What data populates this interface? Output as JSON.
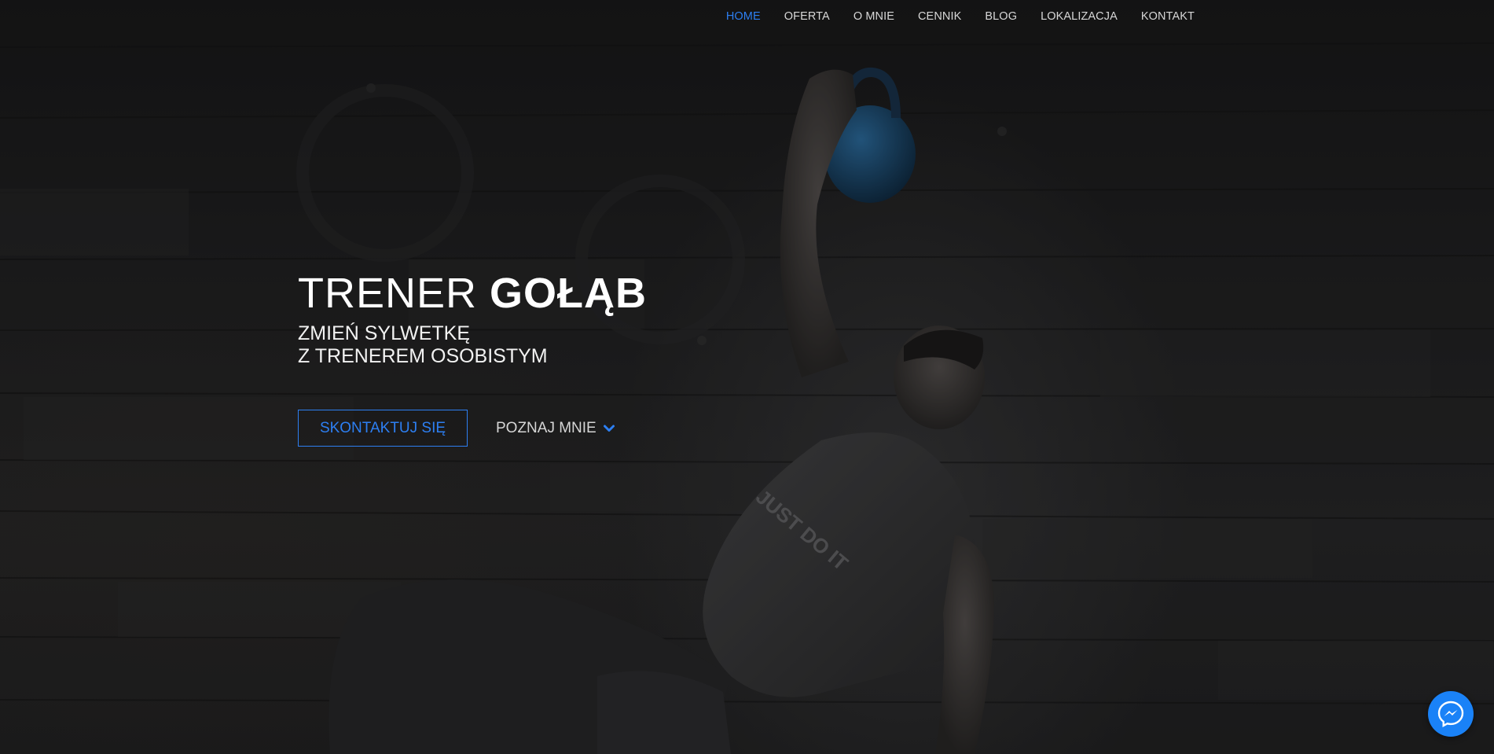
{
  "nav": {
    "items": [
      {
        "label": "HOME",
        "active": true
      },
      {
        "label": "OFERTA",
        "active": false
      },
      {
        "label": "O MNIE",
        "active": false
      },
      {
        "label": "CENNIK",
        "active": false
      },
      {
        "label": "BLOG",
        "active": false
      },
      {
        "label": "LOKALIZACJA",
        "active": false
      },
      {
        "label": "KONTAKT",
        "active": false
      }
    ],
    "active_color": "#2d7ff2",
    "color": "#d8d8d8"
  },
  "hero": {
    "title_light": "TRENER ",
    "title_bold": "GOŁĄB",
    "subtitle_line1": "ZMIEŃ SYLWETKĘ",
    "subtitle_line2": "Z TRENEREM OSOBISTYM",
    "contact_button": "SKONTAKTUJ SIĘ",
    "about_button": "POZNAJ MNIE",
    "about_icon": "chevron-down-icon",
    "accent_color": "#2d7ff2",
    "shirt_print": "JUST DO IT"
  },
  "messenger": {
    "icon": "messenger-icon",
    "color": "#1a82f7"
  }
}
